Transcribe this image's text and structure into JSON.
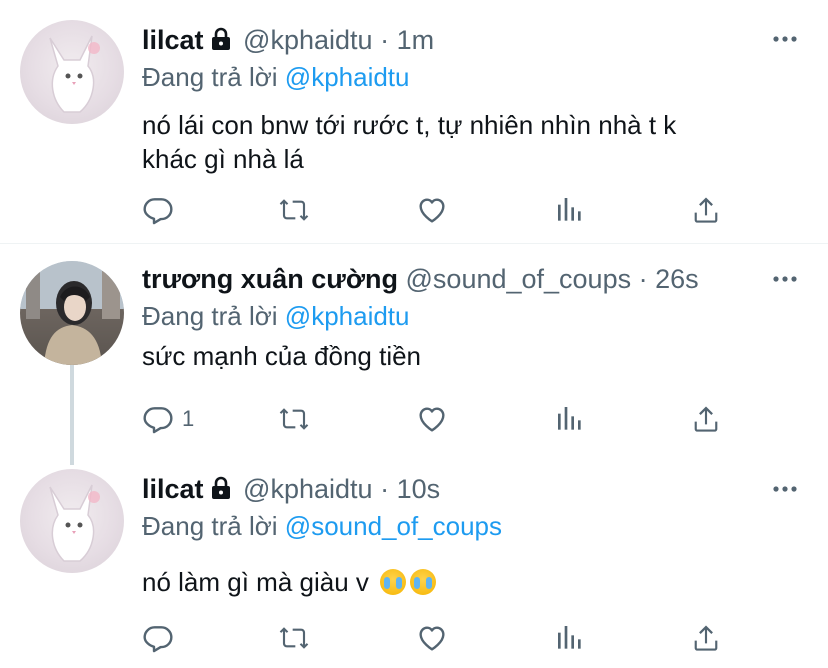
{
  "tweets": [
    {
      "name": "lilcat",
      "handle": "@kphaidtu",
      "dot": "·",
      "time": "1m",
      "replying_prefix": "Đang trả lời",
      "replying_to": "@kphaidtu",
      "text_lines": [
        "nó lái con bnw tới rước t, tự nhiên nhìn nhà t k",
        "khác gì nhà lá"
      ],
      "reply_count": ""
    },
    {
      "name": "trương xuân cường",
      "handle": "@sound_of_coups",
      "dot": "·",
      "time": "26s",
      "replying_prefix": "Đang trả lời",
      "replying_to": "@kphaidtu",
      "text_lines": [
        "sức mạnh của đồng tiền"
      ],
      "reply_count": "1"
    },
    {
      "name": "lilcat",
      "handle": "@kphaidtu",
      "dot": "·",
      "time": "10s",
      "replying_prefix": "Đang trả lời",
      "replying_to": "@sound_of_coups",
      "text_lines": [
        "nó làm gì mà giàu v"
      ],
      "reply_count": ""
    }
  ],
  "icons": {
    "reply": "reply-icon",
    "retweet": "retweet-icon",
    "like": "heart-icon",
    "views": "analytics-icon",
    "share": "share-icon",
    "more": "more-icon",
    "lock": "lock-icon",
    "emoji": "crying-face-emoji"
  },
  "colors": {
    "accent": "#1d9bf0",
    "secondary": "#536471",
    "icon": "#536471"
  }
}
